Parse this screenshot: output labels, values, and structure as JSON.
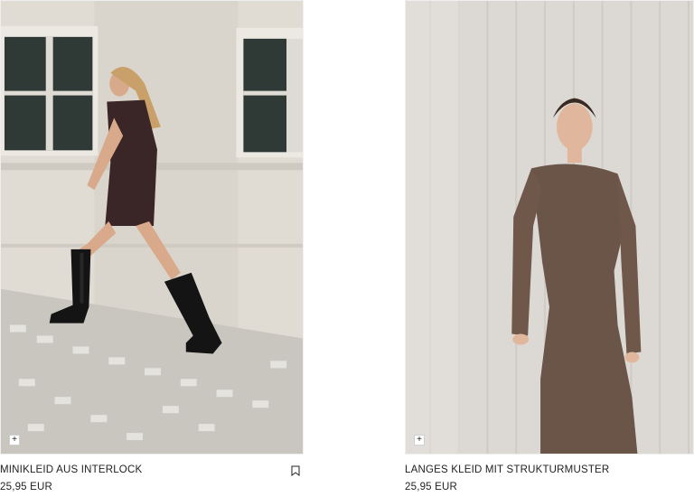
{
  "products": [
    {
      "name": "MINIKLEID AUS INTERLOCK",
      "price": "25,95 EUR",
      "quick_add_icon": "plus-icon",
      "bookmark_icon": "bookmark-icon"
    },
    {
      "name": "LANGES KLEID MIT STRUKTURMUSTER",
      "price": "25,95 EUR",
      "quick_add_icon": "plus-icon"
    }
  ],
  "colors": {
    "text": "#222222",
    "background": "#ffffff"
  }
}
